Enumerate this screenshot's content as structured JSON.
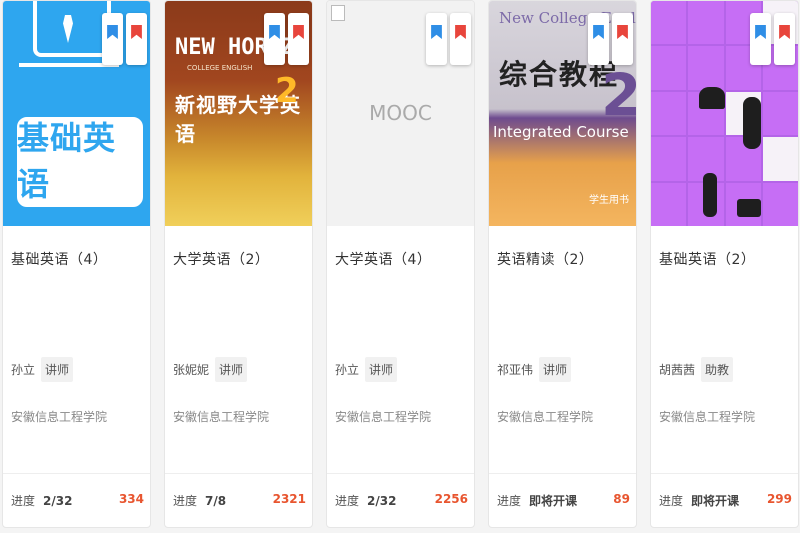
{
  "courses": [
    {
      "title": "基础英语（4）",
      "teacher": "孙立",
      "role": "讲师",
      "school": "安徽信息工程学院",
      "progress_label": "进度",
      "progress_value": "2/32",
      "count": "334",
      "cover_text": "基础英语"
    },
    {
      "title": "大学英语（2）",
      "teacher": "张妮妮",
      "role": "讲师",
      "school": "安徽信息工程学院",
      "progress_label": "进度",
      "progress_value": "7/8",
      "count": "2321",
      "cover_brand": "NEW HORIZ",
      "cover_subtitle": "COLLEGE ENGLISH",
      "cover_text": "新视野大学英语",
      "cover_number": "2"
    },
    {
      "title": "大学英语（4）",
      "teacher": "孙立",
      "role": "讲师",
      "school": "安徽信息工程学院",
      "progress_label": "进度",
      "progress_value": "2/32",
      "count": "2256",
      "cover_text": "MOOC"
    },
    {
      "title": "英语精读（2）",
      "teacher": "祁亚伟",
      "role": "讲师",
      "school": "安徽信息工程学院",
      "progress_label": "进度",
      "progress_value": "即将开课",
      "count": "89",
      "cover_en": "New College English",
      "cover_text": "综合教程",
      "cover_course": "Integrated Course",
      "cover_number": "2",
      "cover_small": "学生用书"
    },
    {
      "title": "基础英语（2）",
      "teacher": "胡茜茜",
      "role": "助教",
      "school": "安徽信息工程学院",
      "progress_label": "进度",
      "progress_value": "即将开课",
      "count": "299"
    }
  ],
  "colors": {
    "accent_count": "#e8552f",
    "bookmark_blue": "#2f8ee6",
    "bookmark_red": "#e8453c"
  },
  "icons": {
    "bookmark_1": "bookmark-blue-icon",
    "bookmark_2": "bookmark-red-icon"
  }
}
